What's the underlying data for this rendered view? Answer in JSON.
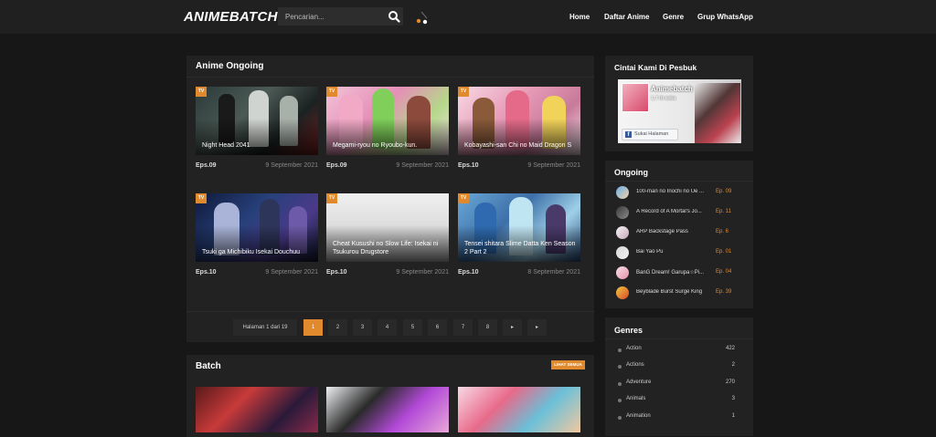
{
  "header": {
    "logo": "ANIMEBATCH",
    "search_placeholder": "Pencarian...",
    "nav": [
      "Home",
      "Daftar Anime",
      "Genre",
      "Grup WhatsApp"
    ]
  },
  "ongoing_section": {
    "title": "Anime Ongoing",
    "cards": [
      {
        "badge": "TV",
        "title": "Night Head 2041",
        "eps": "Eps.09",
        "date": "9 September 2021"
      },
      {
        "badge": "TV",
        "title": "Megami-ryou no Ryoubo-kun.",
        "eps": "Eps.09",
        "date": "9 September 2021"
      },
      {
        "badge": "TV",
        "title": "Kobayashi-san Chi no Maid Dragon S",
        "eps": "Eps.10",
        "date": "9 September 2021"
      },
      {
        "badge": "TV",
        "title": "Tsuki ga Michibiku Isekai Douchuu",
        "eps": "Eps.10",
        "date": "9 September 2021"
      },
      {
        "badge": "TV",
        "title": "Cheat Kusushi no Slow Life: Isekai ni Tsukurou Drugstore",
        "eps": "Eps.10",
        "date": "9 September 2021"
      },
      {
        "badge": "TV",
        "title": "Tensei shitara Slime Datta Ken Season 2 Part 2",
        "eps": "Eps.10",
        "date": "8 September 2021"
      }
    ],
    "pagination": {
      "info": "Halaman 1 dari 19",
      "pages": [
        "1",
        "2",
        "3",
        "4",
        "5",
        "6",
        "7",
        "8"
      ],
      "next": "▸",
      "last": "▸"
    }
  },
  "batch_section": {
    "title": "Batch",
    "view_all": "LIHAT SEMUA"
  },
  "sidebar": {
    "facebook": {
      "title": "Cintai Kami Di Pesbuk",
      "page_name": "Animebatch",
      "likes": "1,7 rb suka",
      "like_button": "Sukai Halaman"
    },
    "ongoing": {
      "title": "Ongoing",
      "items": [
        {
          "name": "100-man no Inochi no Ue ...",
          "ep": "Ep. 09"
        },
        {
          "name": "A Record of A Mortal's Jo...",
          "ep": "Ep. 11"
        },
        {
          "name": "ARP Backstage Pass",
          "ep": "Ep. 6"
        },
        {
          "name": "Bai Yao Pu",
          "ep": "Ep. 01"
        },
        {
          "name": "BanG Dream! Garupa☆Pi...",
          "ep": "Ep. 04"
        },
        {
          "name": "Beyblade Burst Surge King",
          "ep": "Ep. 39"
        }
      ]
    },
    "genres": {
      "title": "Genres",
      "items": [
        {
          "name": "Action",
          "count": "422"
        },
        {
          "name": "Actions",
          "count": "2"
        },
        {
          "name": "Adventure",
          "count": "270"
        },
        {
          "name": "Animals",
          "count": "3"
        },
        {
          "name": "Animation",
          "count": "1"
        }
      ]
    }
  }
}
